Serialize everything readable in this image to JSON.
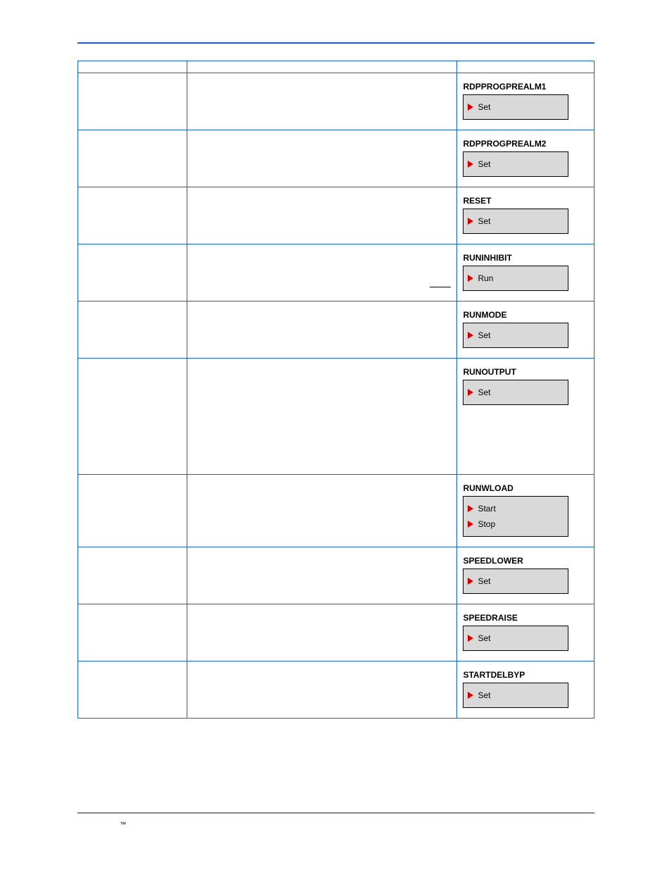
{
  "footer": {
    "tm": "™"
  },
  "rows": [
    {
      "header": true
    },
    {
      "diagram": {
        "title": "RDPPROGPREALM1",
        "pins": [
          "Set"
        ]
      }
    },
    {
      "diagram": {
        "title": "RDPPROGPREALM2",
        "pins": [
          "Set"
        ]
      }
    },
    {
      "diagram": {
        "title": "RESET",
        "pins": [
          "Set"
        ]
      }
    },
    {
      "diagram": {
        "title": "RUNINHIBIT",
        "pins": [
          "Run"
        ]
      },
      "underlineInCol2": true
    },
    {
      "diagram": {
        "title": "RUNMODE",
        "pins": [
          "Set"
        ]
      }
    },
    {
      "diagram": {
        "title": "RUNOUTPUT",
        "pins": [
          "Set"
        ]
      },
      "tall": true
    },
    {
      "diagram": {
        "title": "RUNWLOAD",
        "pins": [
          "Start",
          "Stop"
        ]
      }
    },
    {
      "diagram": {
        "title": "SPEEDLOWER",
        "pins": [
          "Set"
        ]
      }
    },
    {
      "diagram": {
        "title": "SPEEDRAISE",
        "pins": [
          "Set"
        ]
      }
    },
    {
      "diagram": {
        "title": "STARTDELBYP",
        "pins": [
          "Set"
        ]
      }
    }
  ]
}
